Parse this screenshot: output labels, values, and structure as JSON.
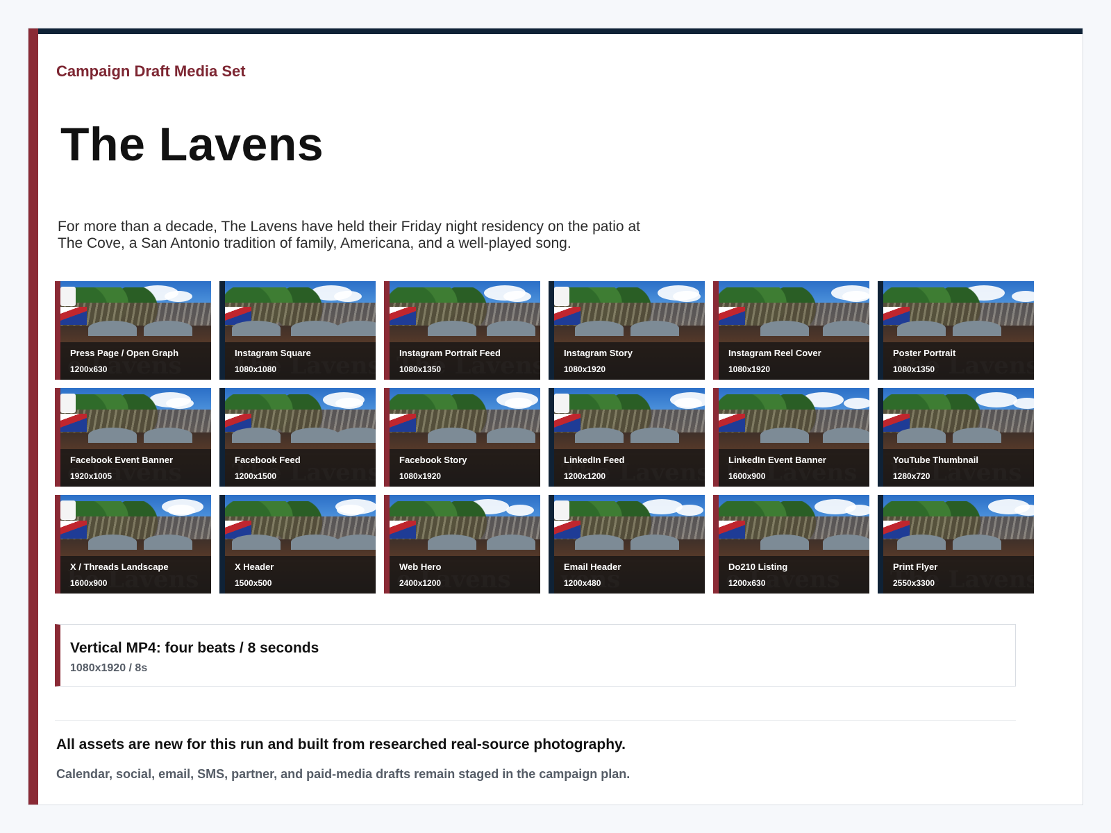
{
  "header": {
    "eyebrow": "Campaign Draft Media Set",
    "title": "The Lavens",
    "intro": "For more than a decade, The Lavens have held their Friday night residency on the patio at The Cove, a San Antonio tradition of family, Americana, and a well-played song."
  },
  "assets": [
    {
      "label": "Press Page / Open Graph",
      "size": "1200x630",
      "ghost": "e Lavens",
      "accent": "red"
    },
    {
      "label": "Instagram Square",
      "size": "1080x1080",
      "ghost": "The Lavens",
      "accent": "navy"
    },
    {
      "label": "Instagram Portrait Feed",
      "size": "1080x1350",
      "ghost": "The Lavens",
      "accent": "red"
    },
    {
      "label": "Instagram Story",
      "size": "1080x1920",
      "ghost": "",
      "accent": "navy"
    },
    {
      "label": "Instagram Reel Cover",
      "size": "1080x1920",
      "ghost": "",
      "accent": "red"
    },
    {
      "label": "Poster Portrait",
      "size": "1080x1350",
      "ghost": "The Lavens",
      "accent": "navy"
    },
    {
      "label": "Facebook Event Banner",
      "size": "1920x1005",
      "ghost": "e Lavens",
      "accent": "red"
    },
    {
      "label": "Facebook Feed",
      "size": "1200x1500",
      "ghost": "The Lavens",
      "accent": "navy"
    },
    {
      "label": "Facebook Story",
      "size": "1080x1920",
      "ghost": "",
      "accent": "red"
    },
    {
      "label": "LinkedIn Feed",
      "size": "1200x1200",
      "ghost": "The Lavens",
      "accent": "navy"
    },
    {
      "label": "LinkedIn Event Banner",
      "size": "1600x900",
      "ghost": "he Lavens",
      "accent": "red"
    },
    {
      "label": "YouTube Thumbnail",
      "size": "1280x720",
      "ghost": "he Lavens",
      "accent": "navy"
    },
    {
      "label": "X / Threads Landscape",
      "size": "1600x900",
      "ghost": "he Lavens",
      "accent": "red"
    },
    {
      "label": "X Header",
      "size": "1500x500",
      "ghost": "",
      "accent": "navy"
    },
    {
      "label": "Web Hero",
      "size": "2400x1200",
      "ghost": "e Lavens",
      "accent": "red"
    },
    {
      "label": "Email Header",
      "size": "1200x480",
      "ghost": "vens",
      "accent": "navy"
    },
    {
      "label": "Do210 Listing",
      "size": "1200x630",
      "ghost": "e Lavens",
      "accent": "red"
    },
    {
      "label": "Print Flyer",
      "size": "2550x3300",
      "ghost": "The Lavens",
      "accent": "navy"
    }
  ],
  "video": {
    "title": "Vertical MP4: four beats / 8 seconds",
    "meta": "1080x1920 / 8s"
  },
  "footer": {
    "headline": "All assets are new for this run and built from researched real-source photography.",
    "note": "Calendar, social, email, SMS, partner, and paid-media drafts remain staged in the campaign plan."
  },
  "colors": {
    "accent_red": "#8a2a35",
    "accent_navy": "#0f2236",
    "eyebrow": "#7d2632"
  }
}
